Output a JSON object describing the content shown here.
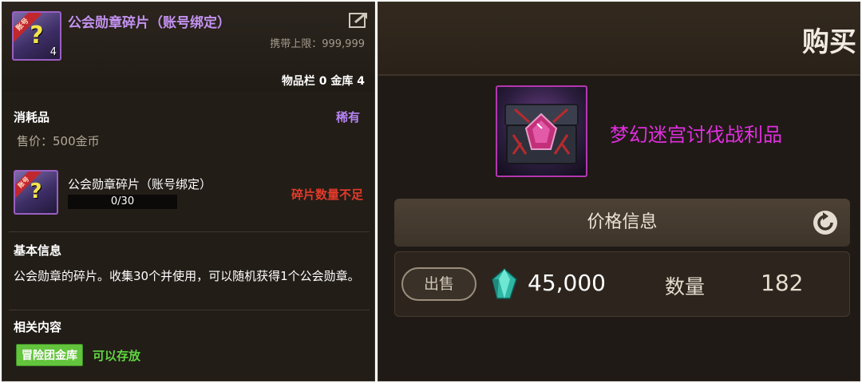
{
  "tooltip": {
    "item_icon_badge": "账号",
    "item_icon_symbol": "?",
    "item_icon_count": "4",
    "title": "公会勋章碎片（账号绑定）",
    "carry_limit": "携带上限：999,999",
    "inventory_counts": "物品栏 0  金库 4",
    "category": "消耗品",
    "rarity": "稀有",
    "sell_price": "售价：500金币",
    "fragment": {
      "name": "公会勋章碎片（账号绑定）",
      "progress_text": "0/30",
      "progress_fraction": 0,
      "status": "碎片数量不足"
    },
    "basic_info_heading": "基本信息",
    "basic_info_text": "公会勋章的碎片。收集30个并使用，可以随机获得1个公会勋章。",
    "related_heading": "相关内容",
    "related_badge": "冒险团金库",
    "related_note": "可以存放"
  },
  "purchase": {
    "title": "购买",
    "item_name": "梦幻迷宫讨伐战利品",
    "price_info_label": "价格信息",
    "sell_button": "出售",
    "price": "45,000",
    "quantity_label": "数量",
    "quantity_value": "182"
  },
  "colors": {
    "title_purple": "#c392f0",
    "rarity_purple": "#b584f2",
    "warning_red": "#e23a2a",
    "badge_green": "#63c43d",
    "chest_name_magenta": "#e12ee0"
  }
}
